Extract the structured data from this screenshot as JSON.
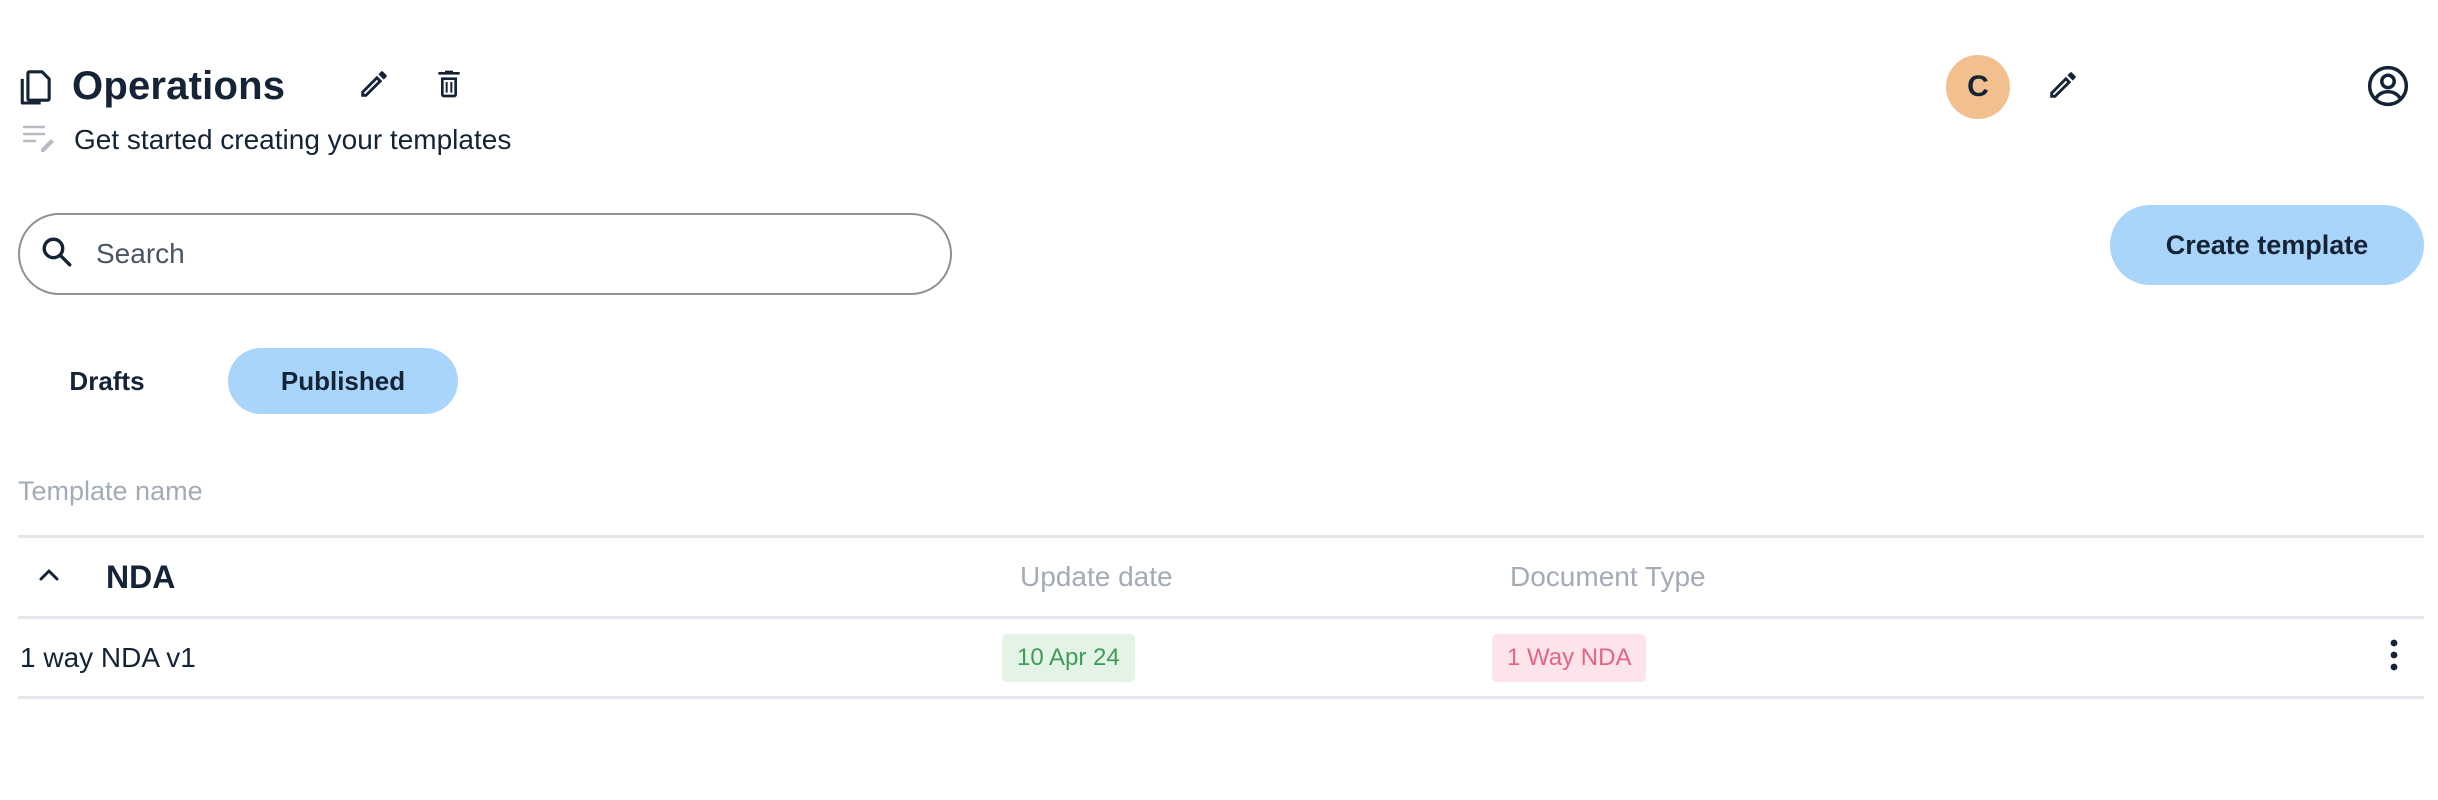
{
  "header": {
    "title": "Operations",
    "subtitle": "Get started creating your templates",
    "icons": {
      "title": "copy-icon",
      "edit": "pencil-icon",
      "delete": "trash-icon",
      "subtitle": "notes-edit-icon",
      "profile": "account-circle-icon"
    }
  },
  "user": {
    "avatar_initial": "C"
  },
  "search": {
    "placeholder": "Search",
    "value": ""
  },
  "actions": {
    "create_label": "Create template"
  },
  "tabs": [
    {
      "label": "Drafts",
      "selected": false
    },
    {
      "label": "Published",
      "selected": true
    }
  ],
  "table": {
    "name_header": "Template name",
    "group": {
      "name": "NDA",
      "expanded": true,
      "update_header": "Update date",
      "doctype_header": "Document Type"
    },
    "rows": [
      {
        "name": "1 way NDA v1",
        "update_date": "10 Apr 24",
        "document_type": "1 Way NDA"
      }
    ]
  },
  "colors": {
    "text": "#142336",
    "accent": "#a9d5fa",
    "avatar": "#f2c08e",
    "muted": "#a3abb6",
    "date_badge_bg": "#e3f4e6",
    "date_badge_text": "#3f9b56",
    "type_badge_bg": "#fde4ea",
    "type_badge_text": "#e4638a"
  }
}
